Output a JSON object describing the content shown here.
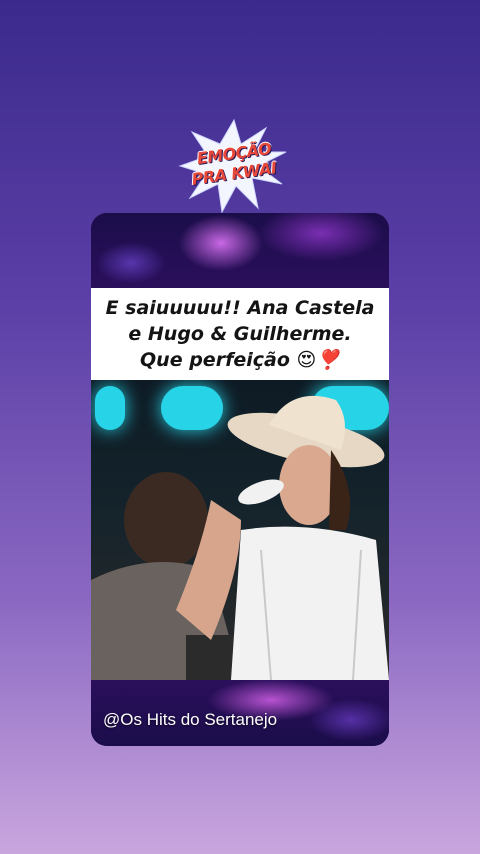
{
  "badge": {
    "line1": "EMOÇÃO",
    "line2": "PRA KWAI"
  },
  "caption": {
    "line1": "E saiuuuuu!! Ana Castela",
    "line2": "e Hugo & Guilherme.",
    "line3": "Que perfeição 😍❣️"
  },
  "footer": {
    "handle": "@Os Hits do Sertanejo"
  },
  "colors": {
    "badge_text": "#e8483a",
    "caption_border": "#b56ad8",
    "neon": "#27d3e6"
  }
}
